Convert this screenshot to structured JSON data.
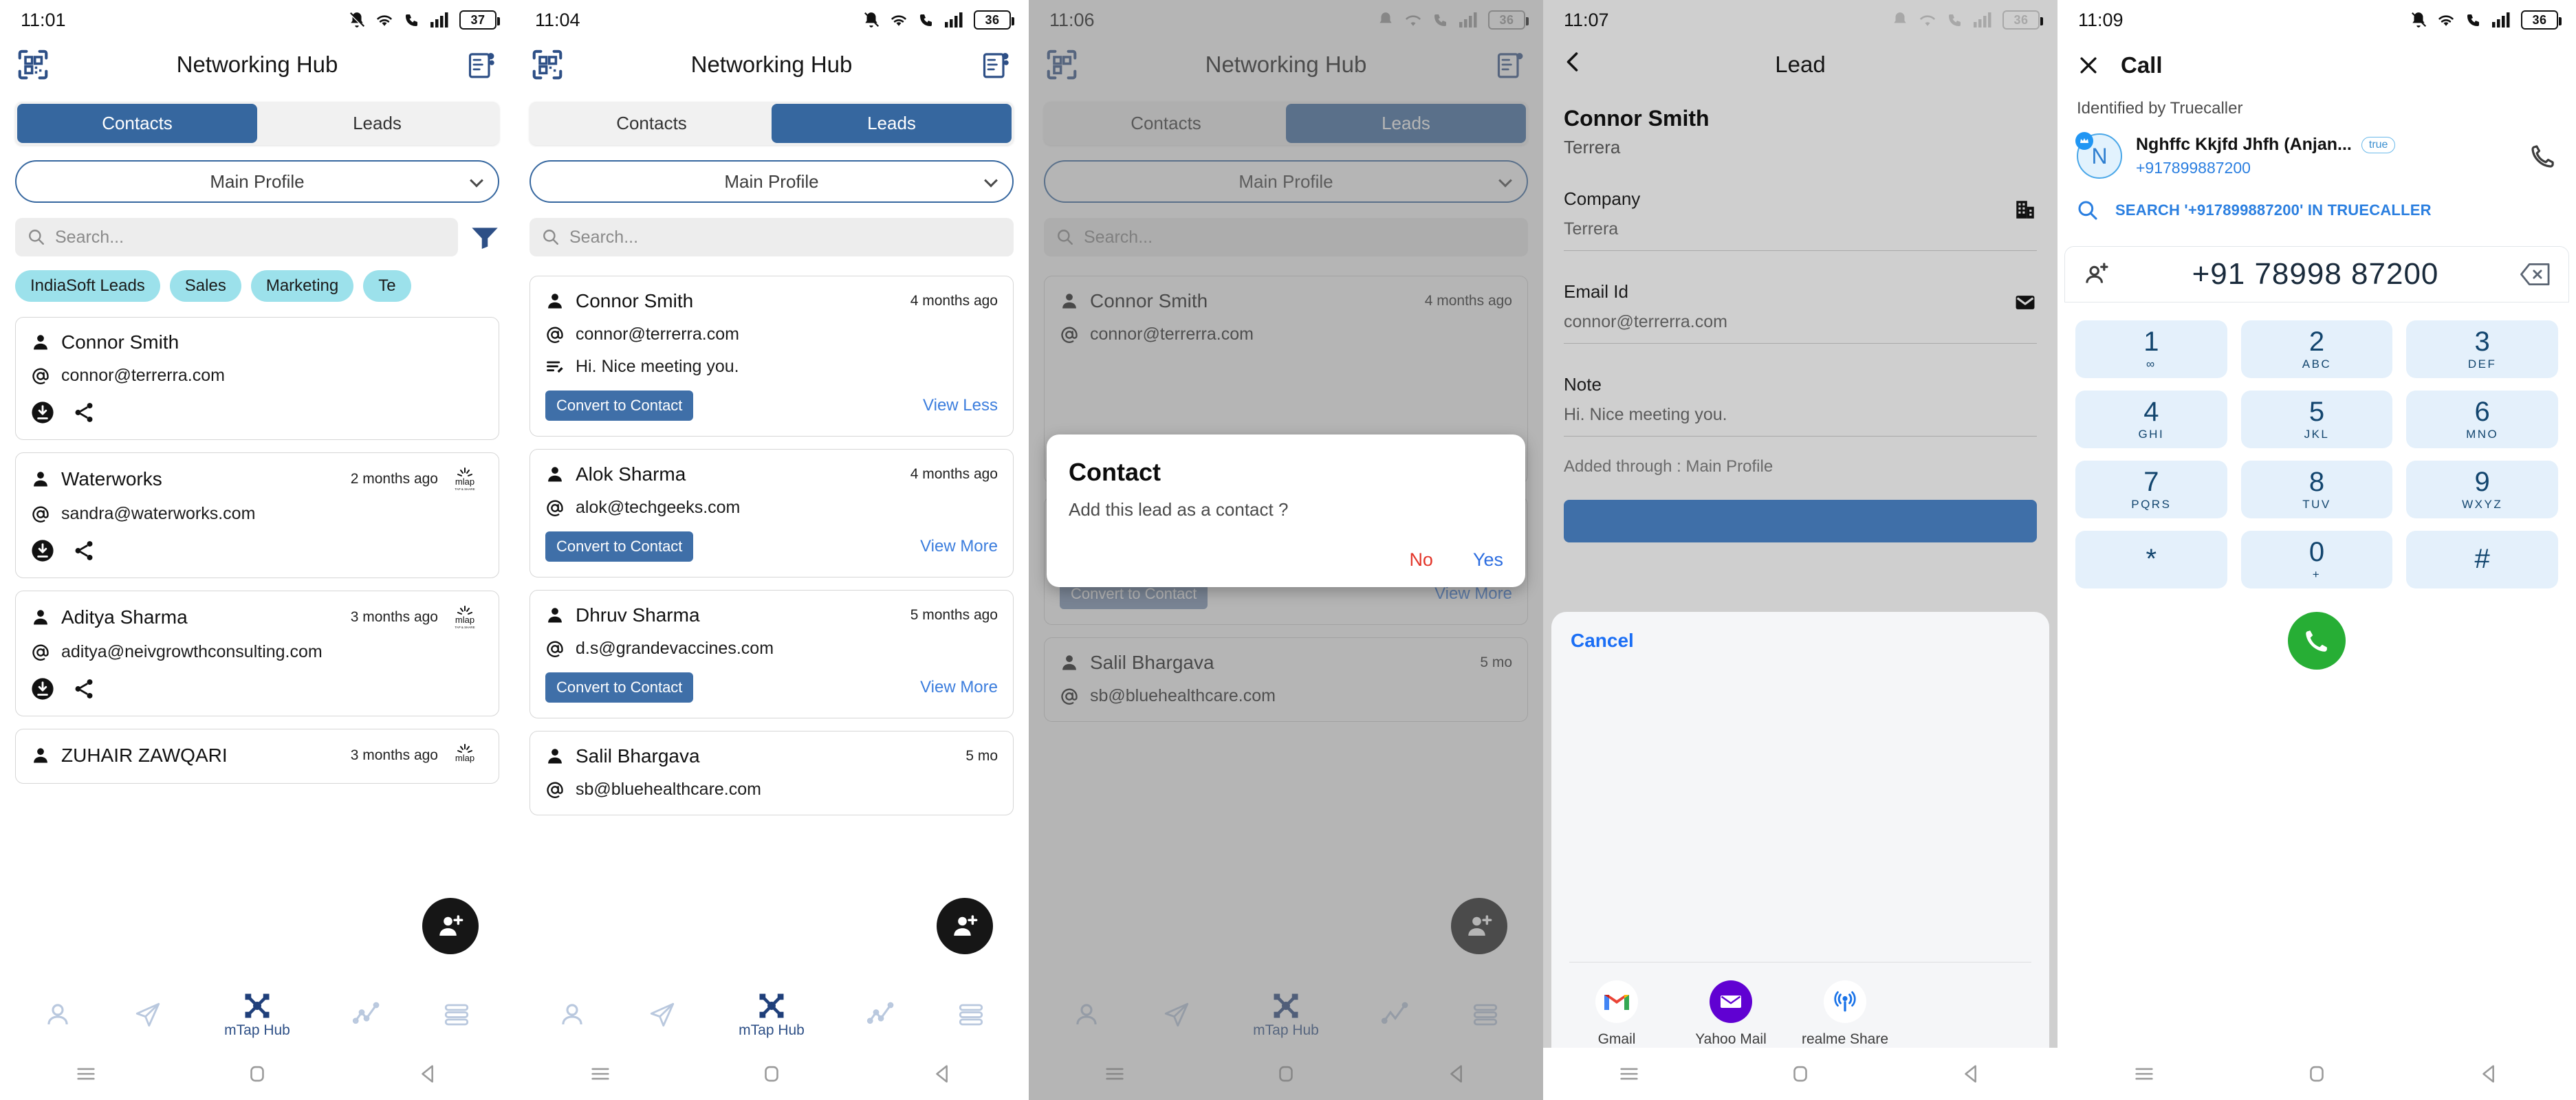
{
  "panels": [
    {
      "status": {
        "time": "11:01",
        "battery": "37",
        "icons": [
          "bell-off-icon",
          "wifi-icon",
          "call-wifi-icon",
          "signal-icon",
          "battery-icon"
        ]
      },
      "header": {
        "title": "Networking Hub",
        "left_icon": "qr-scan-icon",
        "right_icon": "digital-card-icon"
      },
      "tabs": [
        {
          "label": "Contacts",
          "active": true
        },
        {
          "label": "Leads",
          "active": false
        }
      ],
      "profile_select": {
        "value": "Main Profile"
      },
      "search": {
        "placeholder": "Search..."
      },
      "filter_icon": "filter-icon",
      "chips": [
        "IndiaSoft Leads",
        "Sales",
        "Marketing",
        "Te"
      ],
      "cards": [
        {
          "name": "Connor Smith",
          "email": "connor@terrerra.com",
          "time": "",
          "badge": false
        },
        {
          "name": "Waterworks",
          "email": "sandra@waterworks.com",
          "time": "2 months ago",
          "badge": true
        },
        {
          "name": "Aditya Sharma",
          "email": "aditya@neivgrowthconsulting.com",
          "time": "3 months ago",
          "badge": true
        },
        {
          "name": "ZUHAIR ZAWQARI",
          "email": "",
          "time": "3 months ago",
          "badge": true
        }
      ]
    },
    {
      "status": {
        "time": "11:04",
        "battery": "36"
      },
      "header": {
        "title": "Networking Hub"
      },
      "tabs": [
        {
          "label": "Contacts",
          "active": false
        },
        {
          "label": "Leads",
          "active": true
        }
      ],
      "profile_select": {
        "value": "Main Profile"
      },
      "search": {
        "placeholder": "Search..."
      },
      "leads": [
        {
          "name": "Connor Smith",
          "email": "connor@terrerra.com",
          "note": "Hi. Nice meeting you.",
          "time": "4 months ago",
          "convert": "Convert to Contact",
          "view": "View Less"
        },
        {
          "name": "Alok Sharma",
          "email": "alok@techgeeks.com",
          "note": "",
          "time": "4 months ago",
          "convert": "Convert to Contact",
          "view": "View More"
        },
        {
          "name": "Dhruv Sharma",
          "email": "d.s@grandevaccines.com",
          "note": "",
          "time": "5 months ago",
          "convert": "Convert to Contact",
          "view": "View More"
        },
        {
          "name": "Salil Bhargava",
          "email": "sb@bluehealthcare.com",
          "note": "",
          "time": "5 mo",
          "convert": "",
          "view": ""
        }
      ]
    },
    {
      "status": {
        "time": "11:06",
        "battery": "36"
      },
      "header": {
        "title": "Networking Hub"
      },
      "tabs": [
        {
          "label": "Contacts",
          "active": false
        },
        {
          "label": "Leads",
          "active": true
        }
      ],
      "profile_select": {
        "value": "Main Profile"
      },
      "search": {
        "placeholder": "Search..."
      },
      "leads": [
        {
          "name": "Connor Smith",
          "email": "connor@terrerra.com",
          "note": "",
          "time": "4 months ago",
          "convert": "",
          "view": ""
        },
        {
          "name": "",
          "email": "",
          "note": "",
          "time": "",
          "convert": "Convert to Contact",
          "view": "View More"
        },
        {
          "name": "Dhruv Sharma",
          "email": "d.s@grandevaccines.com",
          "note": "",
          "time": "5 months ago",
          "convert": "Convert to Contact",
          "view": "View More"
        },
        {
          "name": "Salil Bhargava",
          "email": "sb@bluehealthcare.com",
          "note": "",
          "time": "5 mo",
          "convert": "",
          "view": ""
        }
      ],
      "dialog": {
        "title": "Contact",
        "message": "Add this lead as a contact ?",
        "no": "No",
        "yes": "Yes"
      }
    },
    {
      "status": {
        "time": "11:07",
        "battery": "36"
      },
      "header": {
        "title": "Lead",
        "back_icon": "back-chevron-icon"
      },
      "lead": {
        "name": "Connor Smith",
        "subtitle": "Terrera",
        "fields": [
          {
            "label": "Company",
            "value": "Terrera",
            "icon": "building-icon"
          },
          {
            "label": "Email Id",
            "value": "connor@terrerra.com",
            "icon": "envelope-icon"
          },
          {
            "label": "Note",
            "value": "Hi. Nice meeting you.",
            "icon": ""
          }
        ],
        "added_through": "Added through : Main Profile"
      },
      "sharesheet": {
        "cancel": "Cancel",
        "apps": [
          {
            "label": "Gmail",
            "icon": "gmail-icon"
          },
          {
            "label": "Yahoo Mail",
            "icon": "yahoo-mail-icon"
          },
          {
            "label": "realme Share",
            "icon": "realme-share-icon"
          }
        ]
      }
    },
    {
      "status": {
        "time": "11:09",
        "battery": "36"
      },
      "header": {
        "title": "Call",
        "close_icon": "close-icon"
      },
      "identified_by": "Identified by Truecaller",
      "caller": {
        "initial": "N",
        "name": "Nghffc Kkjfd Jhfh (Anjan...",
        "badge": "true",
        "phone": "+917899887200",
        "call_icon": "phone-outline-icon"
      },
      "search_truecaller": "SEARCH '+917899887200' IN TRUECALLER",
      "dial_value": "+91 78998 87200",
      "add_contact_icon": "add-person-icon",
      "backspace_icon": "backspace-icon",
      "keys": [
        {
          "d": "1",
          "s": "∞"
        },
        {
          "d": "2",
          "s": "ABC"
        },
        {
          "d": "3",
          "s": "DEF"
        },
        {
          "d": "4",
          "s": "GHI"
        },
        {
          "d": "5",
          "s": "JKL"
        },
        {
          "d": "6",
          "s": "MNO"
        },
        {
          "d": "7",
          "s": "PQRS"
        },
        {
          "d": "8",
          "s": "TUV"
        },
        {
          "d": "9",
          "s": "WXYZ"
        },
        {
          "d": "*",
          "s": ""
        },
        {
          "d": "0",
          "s": "+"
        },
        {
          "d": "#",
          "s": ""
        }
      ],
      "call_button_icon": "phone-filled-icon"
    }
  ],
  "bottom_nav": {
    "items": [
      {
        "icon": "person-icon",
        "label": ""
      },
      {
        "icon": "send-icon",
        "label": ""
      },
      {
        "icon": "mtap-hub-icon",
        "label": "mTap Hub"
      },
      {
        "icon": "analytics-icon",
        "label": ""
      },
      {
        "icon": "list-icon",
        "label": ""
      }
    ]
  },
  "system_nav": {
    "menu": "menu-icon",
    "home": "home-icon",
    "back": "back-icon"
  },
  "colors": {
    "primary": "#36679f",
    "chip": "#9ce1eb",
    "link": "#3b7ddd",
    "danger": "#e3362a",
    "call": "#27ae35",
    "keypad": "#e4f0fb"
  }
}
